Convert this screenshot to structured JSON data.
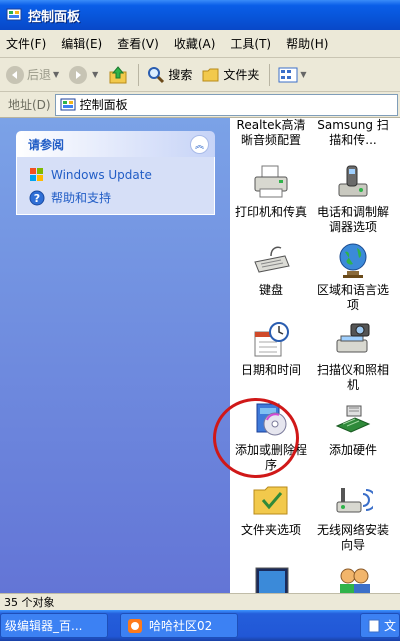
{
  "window": {
    "title": "控制面板"
  },
  "menu": [
    "文件(F)",
    "编辑(E)",
    "查看(V)",
    "收藏(A)",
    "工具(T)",
    "帮助(H)"
  ],
  "toolbar": {
    "back": "后退",
    "search": "搜索",
    "folders": "文件夹"
  },
  "address": {
    "label": "地址(D)",
    "value": "控制面板"
  },
  "sidebar": {
    "panel_title": "请参阅",
    "links": [
      "Windows Update",
      "帮助和支持"
    ]
  },
  "items": [
    {
      "label": "Realtek高清晰音频配置",
      "icon": "realtek-audio-icon"
    },
    {
      "label": "Samsung 扫描和传...",
      "icon": "samsung-scan-icon"
    },
    {
      "label": "打印机和传真",
      "icon": "printer-icon"
    },
    {
      "label": "电话和调制解调器选项",
      "icon": "phone-modem-icon"
    },
    {
      "label": "键盘",
      "icon": "keyboard-icon"
    },
    {
      "label": "区域和语言选项",
      "icon": "globe-icon"
    },
    {
      "label": "日期和时间",
      "icon": "calendar-clock-icon"
    },
    {
      "label": "扫描仪和照相机",
      "icon": "scanner-camera-icon"
    },
    {
      "label": "添加或删除程序",
      "icon": "add-remove-programs-icon"
    },
    {
      "label": "添加硬件",
      "icon": "add-hardware-icon"
    },
    {
      "label": "文件夹选项",
      "icon": "folder-options-icon"
    },
    {
      "label": "无线网络安装向导",
      "icon": "wireless-network-icon"
    }
  ],
  "status": {
    "text": "35 个对象"
  },
  "taskbar": [
    {
      "label": "级编辑器_百..."
    },
    {
      "label": "哈哈社区02"
    },
    {
      "label": "文"
    }
  ],
  "colors": {
    "title_blue": "#0854d8",
    "pane_blue": "#6375d6",
    "link_blue": "#215dc6",
    "highlight_red": "#d01818"
  }
}
